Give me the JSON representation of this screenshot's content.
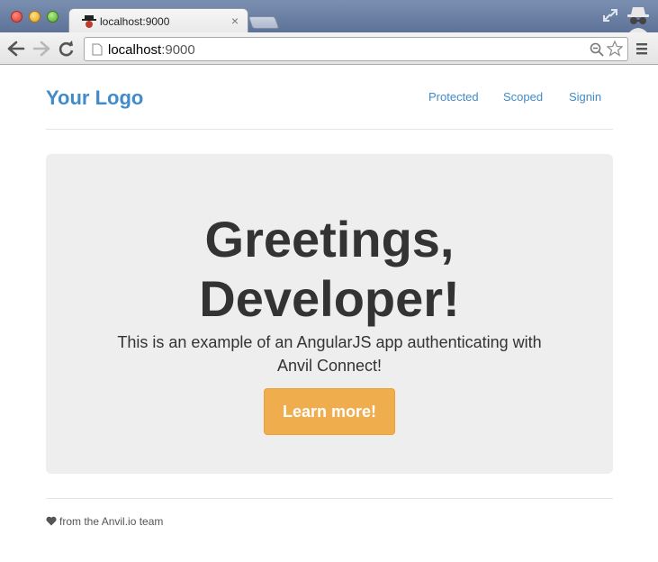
{
  "browser": {
    "tab_title": "localhost:9000",
    "tab_close": "×",
    "url_host": "localhost",
    "url_port": ":9000"
  },
  "navbar": {
    "brand": "Your Logo",
    "links": [
      {
        "label": "Protected"
      },
      {
        "label": "Scoped"
      },
      {
        "label": "Signin"
      }
    ]
  },
  "jumbotron": {
    "title_line1": "Greetings,",
    "title_line2": "Developer!",
    "lead": "This is an example of an AngularJS app authenticating with Anvil Connect!",
    "button_label": "Learn more!"
  },
  "footer": {
    "text": "from the Anvil.io team"
  },
  "colors": {
    "link": "#428bca",
    "button": "#f0ad4e",
    "jumbotron_bg": "#eeeeee"
  },
  "icons": [
    "back-icon",
    "forward-icon",
    "reload-icon",
    "page-icon",
    "zoom-icon",
    "star-icon",
    "menu-icon",
    "heart-icon",
    "incognito-icon",
    "expand-icon"
  ]
}
